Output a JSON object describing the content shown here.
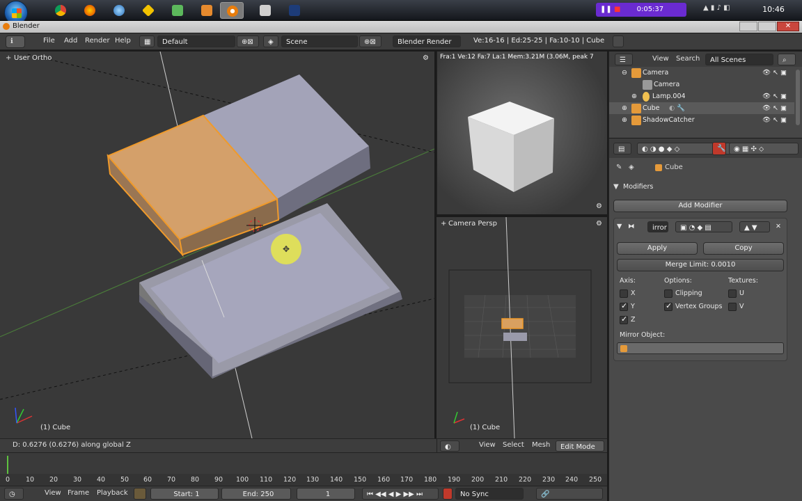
{
  "taskbar": {
    "recorder_time": "0:05:37",
    "clock": "10:46"
  },
  "window": {
    "title": "Blender"
  },
  "header": {
    "menus": [
      "File",
      "Add",
      "Render",
      "Help"
    ],
    "layout": "Default",
    "scene": "Scene",
    "engine": "Blender Render",
    "stats": "Ve:16-16 | Ed:25-25 | Fa:10-10 | Cube"
  },
  "viewport": {
    "label": "User Ortho",
    "object": "(1) Cube",
    "status": "D: 0.6276 (0.6276) along global Z"
  },
  "render": {
    "info": "Fra:1  Ve:12 Fa:7 La:1 Mem:3.21M (3.06M, peak 7"
  },
  "camera": {
    "label": "Camera Persp",
    "object": "(1) Cube",
    "menus": [
      "View",
      "Select",
      "Mesh"
    ],
    "mode": "Edit Mode"
  },
  "outliner": {
    "menus": [
      "View",
      "Search"
    ],
    "filter": "All Scenes",
    "items": [
      "Camera",
      "Camera",
      "Lamp.004",
      "Cube",
      "ShadowCatcher"
    ]
  },
  "properties": {
    "context": "Cube",
    "section": "Modifiers",
    "add_modifier": "Add Modifier",
    "modifier_name": "irror",
    "apply": "Apply",
    "copy": "Copy",
    "merge_limit": "Merge Limit: 0.0010",
    "axis_label": "Axis:",
    "options_label": "Options:",
    "textures_label": "Textures:",
    "axis": [
      "X",
      "Y",
      "Z"
    ],
    "options": [
      "Clipping",
      "Vertex Groups"
    ],
    "textures": [
      "U",
      "V"
    ],
    "mirror_object": "Mirror Object:"
  },
  "timeline": {
    "ticks": [
      "0",
      "10",
      "20",
      "30",
      "40",
      "50",
      "60",
      "70",
      "80",
      "90",
      "100",
      "110",
      "120",
      "130",
      "140",
      "150",
      "160",
      "170",
      "180",
      "190",
      "200",
      "210",
      "220",
      "230",
      "240",
      "250"
    ],
    "menus": [
      "View",
      "Frame",
      "Playback"
    ],
    "start": "Start: 1",
    "end": "End: 250",
    "current": "1",
    "sync": "No Sync"
  }
}
